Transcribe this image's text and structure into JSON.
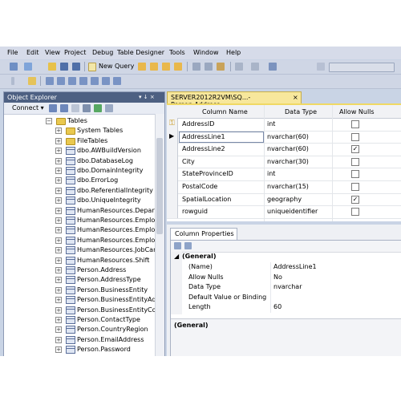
{
  "menu": [
    "File",
    "Edit",
    "View",
    "Project",
    "Debug",
    "Table Designer",
    "Tools",
    "Window",
    "Help"
  ],
  "toolbar": {
    "new_query_label": "New Query"
  },
  "object_explorer": {
    "title": "Object Explorer",
    "pin_glyphs": "▾ ↓ ×",
    "connect_label": "Connect ▾",
    "tree": [
      {
        "label": "Tables",
        "kind": "folder",
        "expanded": true,
        "indent": 0
      },
      {
        "label": "System Tables",
        "kind": "folder",
        "expanded": false,
        "indent": 1
      },
      {
        "label": "FileTables",
        "kind": "folder",
        "expanded": false,
        "indent": 1
      },
      {
        "label": "dbo.AWBuildVersion",
        "kind": "table",
        "indent": 1
      },
      {
        "label": "dbo.DatabaseLog",
        "kind": "table",
        "indent": 1
      },
      {
        "label": "dbo.DomainIntegrity",
        "kind": "table",
        "indent": 1
      },
      {
        "label": "dbo.ErrorLog",
        "kind": "table",
        "indent": 1
      },
      {
        "label": "dbo.ReferentialIntegrity",
        "kind": "table",
        "indent": 1
      },
      {
        "label": "dbo.UniqueIntegrity",
        "kind": "table",
        "indent": 1
      },
      {
        "label": "HumanResources.Departme",
        "kind": "table",
        "indent": 1
      },
      {
        "label": "HumanResources.Employe",
        "kind": "table",
        "indent": 1
      },
      {
        "label": "HumanResources.Employe",
        "kind": "table",
        "indent": 1
      },
      {
        "label": "HumanResources.Employe",
        "kind": "table",
        "indent": 1
      },
      {
        "label": "HumanResources.JobCandi",
        "kind": "table",
        "indent": 1
      },
      {
        "label": "HumanResources.Shift",
        "kind": "table",
        "indent": 1
      },
      {
        "label": "Person.Address",
        "kind": "table",
        "indent": 1
      },
      {
        "label": "Person.AddressType",
        "kind": "table",
        "indent": 1
      },
      {
        "label": "Person.BusinessEntity",
        "kind": "table",
        "indent": 1
      },
      {
        "label": "Person.BusinessEntityAddre",
        "kind": "table",
        "indent": 1
      },
      {
        "label": "Person.BusinessEntityConta",
        "kind": "table",
        "indent": 1
      },
      {
        "label": "Person.ContactType",
        "kind": "table",
        "indent": 1
      },
      {
        "label": "Person.CountryRegion",
        "kind": "table",
        "indent": 1
      },
      {
        "label": "Person.EmailAddress",
        "kind": "table",
        "indent": 1
      },
      {
        "label": "Person.Password",
        "kind": "table",
        "indent": 1
      }
    ]
  },
  "document_tab": {
    "title": "SERVER2012R2VM\\SQ...- Person.Address",
    "close": "×"
  },
  "designer": {
    "headers": {
      "column_name": "Column Name",
      "data_type": "Data Type",
      "allow_nulls": "Allow Nulls"
    },
    "editing_value": "AddressLine1",
    "rows": [
      {
        "name": "AddressID",
        "type": "int",
        "nulls": false,
        "key": true
      },
      {
        "name": "AddressLine1",
        "type": "nvarchar(60)",
        "nulls": false,
        "current": true
      },
      {
        "name": "AddressLine2",
        "type": "nvarchar(60)",
        "nulls": true
      },
      {
        "name": "City",
        "type": "nvarchar(30)",
        "nulls": false
      },
      {
        "name": "StateProvinceID",
        "type": "int",
        "nulls": false
      },
      {
        "name": "PostalCode",
        "type": "nvarchar(15)",
        "nulls": false
      },
      {
        "name": "SpatialLocation",
        "type": "geography",
        "nulls": true
      },
      {
        "name": "rowguid",
        "type": "uniqueidentifier",
        "nulls": false
      }
    ]
  },
  "column_properties": {
    "tab_label": "Column Properties",
    "group": "(General)",
    "props": [
      {
        "name": "(Name)",
        "value": "AddressLine1"
      },
      {
        "name": "Allow Nulls",
        "value": "No"
      },
      {
        "name": "Data Type",
        "value": "nvarchar"
      },
      {
        "name": "Default Value or Binding",
        "value": ""
      },
      {
        "name": "Length",
        "value": "60"
      }
    ],
    "description_title": "(General)"
  }
}
